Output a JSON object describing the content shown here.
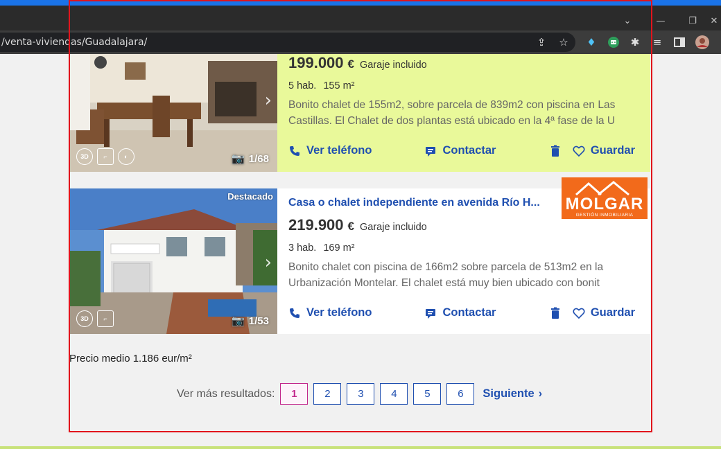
{
  "browser": {
    "url": "/venta-viviendas/Guadalajara/",
    "accent_color": "#1a73e8",
    "controls": [
      "chevron-down",
      "minimize",
      "restore",
      "close"
    ]
  },
  "listings": [
    {
      "highlighted": true,
      "background": "#e9f99a",
      "price": "199.000",
      "currency": "€",
      "parking": "Garaje incluido",
      "rooms": "5 hab.",
      "area": "155 m²",
      "description": "Bonito chalet de 155m2, sobre parcela de 839m2 con piscina en Las Castillas. El Chalet de dos plantas está ubicado en la 4ª fase de la U",
      "photo_counter": "1/68",
      "actions": {
        "phone": "Ver teléfono",
        "contact": "Contactar",
        "save": "Guardar"
      }
    },
    {
      "highlighted": false,
      "badge": "Destacado",
      "title": "Casa o chalet independiente en avenida Río H...",
      "agency": {
        "name": "MOLGAR",
        "tagline": "GESTIÓN INMOBILIARIA"
      },
      "price": "219.900",
      "currency": "€",
      "parking": "Garaje incluido",
      "rooms": "3 hab.",
      "area": "169 m²",
      "description": "Bonito chalet con piscina de 166m2 sobre parcela de 513m2 en la Urbanización Montelar. El chalet está muy bien ubicado con bonit",
      "photo_counter": "1/53",
      "actions": {
        "phone": "Ver teléfono",
        "contact": "Contactar",
        "save": "Guardar"
      }
    }
  ],
  "avg_price": "Precio medio 1.186 eur/m²",
  "pagination": {
    "label": "Ver más resultados:",
    "pages": [
      "1",
      "2",
      "3",
      "4",
      "5",
      "6"
    ],
    "current": "1",
    "next": "Siguiente"
  },
  "colors": {
    "link": "#1f4fb0",
    "active_page": "#c2278c",
    "frame": "#e1141c"
  }
}
